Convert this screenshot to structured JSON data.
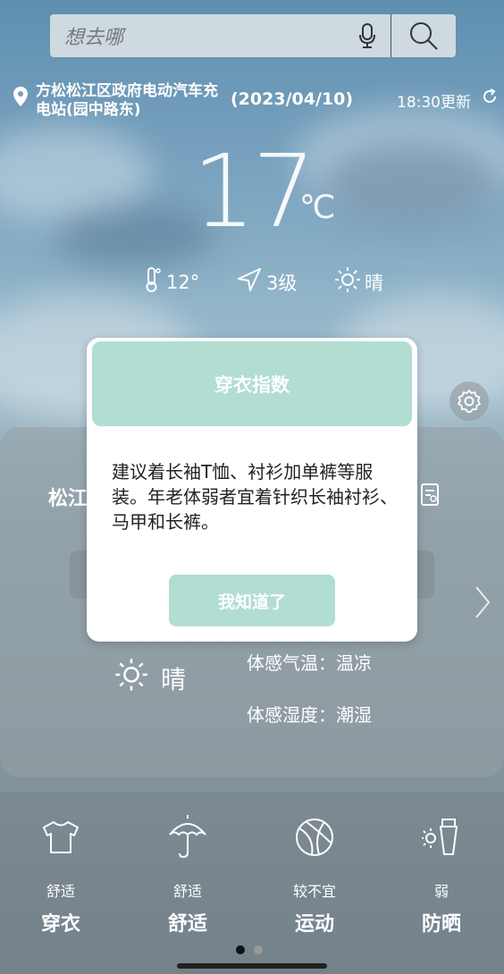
{
  "search": {
    "placeholder": "想去哪"
  },
  "location": {
    "place": "方松松江区政府电动汽车充电站(园中路东)",
    "date": "(2023/04/10)",
    "updated": "18:30更新"
  },
  "weather": {
    "temperature": "17",
    "unit": "℃",
    "low_temp": "12°",
    "wind": "3级",
    "condition": "晴"
  },
  "card": {
    "city": "松江",
    "condition": "晴",
    "feel_temp": "体感气温：温凉",
    "feel_humidity": "体感湿度：潮湿"
  },
  "bottom_items": [
    {
      "level": "舒适",
      "name": "穿衣",
      "icon": "shirt-icon"
    },
    {
      "level": "舒适",
      "name": "舒适",
      "icon": "umbrella-icon"
    },
    {
      "level": "较不宜",
      "name": "运动",
      "icon": "basketball-icon"
    },
    {
      "level": "弱",
      "name": "防晒",
      "icon": "sunscreen-icon"
    }
  ],
  "modal": {
    "title": "穿衣指数",
    "message": "建议着长袖T恤、衬衫加单裤等服装。年老体弱者宜着针织长袖衬衫、马甲和长裤。",
    "ok_label": "我知道了"
  },
  "colors": {
    "accent": "#b2ddd3"
  }
}
